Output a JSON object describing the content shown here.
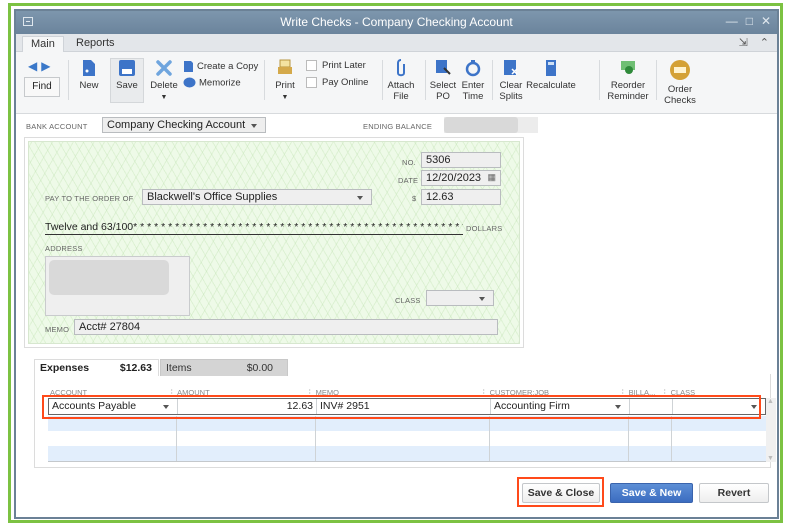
{
  "window": {
    "title": "Write Checks - Company Checking Account",
    "controls": [
      "minimize",
      "maximize",
      "close"
    ]
  },
  "ribbon": {
    "tabs": [
      {
        "label": "Main",
        "active": true
      },
      {
        "label": "Reports",
        "active": false
      }
    ],
    "right_controls": [
      "expand-icon",
      "collapse-icon"
    ]
  },
  "toolbar": {
    "find": "Find",
    "new": "New",
    "save": "Save",
    "delete": "Delete",
    "create_copy": "Create a Copy",
    "memorize": "Memorize",
    "print": "Print",
    "print_later": "Print Later",
    "pay_online": "Pay Online",
    "attach_file_1": "Attach",
    "attach_file_2": "File",
    "select_po_1": "Select",
    "select_po_2": "PO",
    "enter_time_1": "Enter",
    "enter_time_2": "Time",
    "clear_splits_1": "Clear",
    "clear_splits_2": "Splits",
    "recalculate": "Recalculate",
    "reorder_1": "Reorder",
    "reorder_2": "Reminder",
    "order_checks_1": "Order",
    "order_checks_2": "Checks",
    "print_later_checked": false,
    "pay_online_checked": false
  },
  "header": {
    "bank_account_label": "BANK ACCOUNT",
    "bank_account_value": "Company Checking Account",
    "ending_balance_label": "ENDING BALANCE"
  },
  "check": {
    "no_label": "NO.",
    "no_value": "5306",
    "date_label": "DATE",
    "date_value": "12/20/2023",
    "pay_to_label": "PAY TO THE ORDER OF",
    "pay_to_value": "Blackwell's Office Supplies",
    "amount_label": "$",
    "amount_value": "12.63",
    "amount_words": "Twelve and 63/100* * * * * * * * * * * * * * * * * * * * * * * * * * * * * * * * * * * * * * * * * * * * * * * * * * * *",
    "dollars_label": "DOLLARS",
    "address_label": "ADDRESS",
    "class_label": "CLASS",
    "class_value": "",
    "memo_label": "MEMO",
    "memo_value": "Acct# 27804"
  },
  "splits": {
    "tabs": [
      {
        "label": "Expenses",
        "amount": "$12.63",
        "active": true
      },
      {
        "label": "Items",
        "amount": "$0.00",
        "active": false
      }
    ],
    "columns": [
      "ACCOUNT",
      "AMOUNT",
      "MEMO",
      "CUSTOMER:JOB",
      "BILLA...",
      "CLASS"
    ],
    "rows": [
      {
        "account": "Accounts Payable",
        "amount": "12.63",
        "memo": "INV# 2951",
        "customer_job": "Accounting Firm",
        "billable": "",
        "class": ""
      },
      {
        "account": "",
        "amount": "",
        "memo": "",
        "customer_job": "",
        "billable": "",
        "class": ""
      },
      {
        "account": "",
        "amount": "",
        "memo": "",
        "customer_job": "",
        "billable": "",
        "class": ""
      },
      {
        "account": "",
        "amount": "",
        "memo": "",
        "customer_job": "",
        "billable": "",
        "class": ""
      }
    ]
  },
  "footer": {
    "save_close": "Save & Close",
    "save_new": "Save & New",
    "revert": "Revert"
  },
  "colors": {
    "highlight": "#ff4a1a",
    "primary_button": "#3b6cc0",
    "frame_green": "#7cc242",
    "titlebar": "#6b849c",
    "check_bg": "#eefae8"
  }
}
